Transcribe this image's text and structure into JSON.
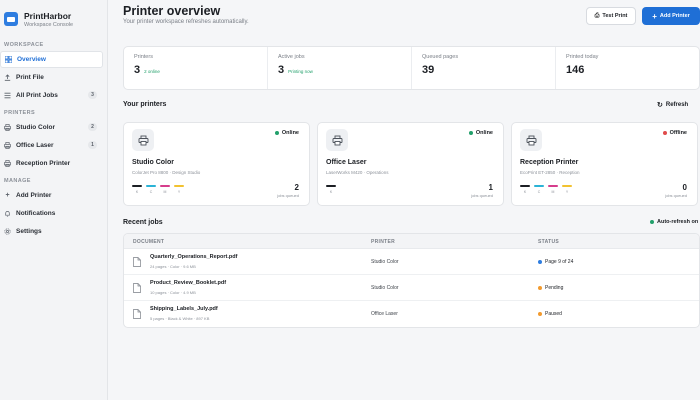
{
  "brand": {
    "name": "PrintHarbor",
    "subtitle": "Workspace Console"
  },
  "sidebar": {
    "workspace_label": "WORKSPACE",
    "workspace_items": [
      {
        "label": "Overview",
        "icon": "grid-icon"
      },
      {
        "label": "Print File",
        "icon": "upload-icon"
      },
      {
        "label": "All Print Jobs",
        "icon": "list-icon",
        "count": "3"
      }
    ],
    "printers_label": "PRINTERS",
    "printer_items": [
      {
        "label": "Studio Color",
        "icon": "printer-icon",
        "count": "2"
      },
      {
        "label": "Office Laser",
        "icon": "printer-icon",
        "count": "1"
      },
      {
        "label": "Reception Printer",
        "icon": "printer-icon"
      }
    ],
    "manage_label": "MANAGE",
    "manage_items": [
      {
        "label": "Add Printer",
        "icon": "plus-icon"
      },
      {
        "label": "Notifications",
        "icon": "bell-icon"
      },
      {
        "label": "Settings",
        "icon": "gear-icon"
      }
    ]
  },
  "header": {
    "title": "Printer overview",
    "subtitle": "Your printer workspace refreshes automatically.",
    "test_print_label": "Test Print",
    "add_printer_label": "Add Printer"
  },
  "stats": [
    {
      "label": "Printers",
      "value": "3",
      "note": "2 online"
    },
    {
      "label": "Active jobs",
      "value": "3",
      "note": "Printing now"
    },
    {
      "label": "Queued pages",
      "value": "39",
      "note": ""
    },
    {
      "label": "Printed today",
      "value": "146",
      "note": ""
    }
  ],
  "printers_section": {
    "title": "Your printers",
    "refresh_label": "Refresh"
  },
  "printers": [
    {
      "name": "Studio Color",
      "model": "ColorJet Pro 8800 · Design Studio",
      "status": "Online",
      "status_color": "#22a06b",
      "jobs": "2",
      "jobs_label": "jobs queued",
      "inks": [
        "K",
        "C",
        "M",
        "Y"
      ],
      "ink_colors": [
        "#1c1f24",
        "#2bb3d6",
        "#d63d8c",
        "#f2c230"
      ]
    },
    {
      "name": "Office Laser",
      "model": "LaserWorks M420 · Operations",
      "status": "Online",
      "status_color": "#22a06b",
      "jobs": "1",
      "jobs_label": "jobs queued",
      "inks": [
        "K"
      ],
      "ink_colors": [
        "#1c1f24"
      ]
    },
    {
      "name": "Reception Printer",
      "model": "EcoPrint ET-2850 · Reception",
      "status": "Offline",
      "status_color": "#e04b4b",
      "jobs": "0",
      "jobs_label": "jobs queued",
      "inks": [
        "K",
        "C",
        "M",
        "Y"
      ],
      "ink_colors": [
        "#1c1f24",
        "#2bb3d6",
        "#d63d8c",
        "#f2c230"
      ]
    }
  ],
  "jobs_section": {
    "title": "Recent jobs",
    "auto_refresh_label": "Auto-refresh on",
    "auto_refresh_color": "#22a06b"
  },
  "jobs_table": {
    "headers": [
      "DOCUMENT",
      "PRINTER",
      "STATUS"
    ],
    "rows": [
      {
        "name": "Quarterly_Operations_Report.pdf",
        "meta": "24 pages · Color · 9.6 MB",
        "printer": "Studio Color",
        "status": "Page 9 of 24",
        "status_color": "#2e7de0"
      },
      {
        "name": "Product_Review_Booklet.pdf",
        "meta": "10 pages · Color · 4.9 MB",
        "printer": "Studio Color",
        "status": "Pending",
        "status_color": "#f29a2e"
      },
      {
        "name": "Shipping_Labels_July.pdf",
        "meta": "5 pages · Black & White · 897 KB",
        "printer": "Office Laser",
        "status": "Paused",
        "status_color": "#f29a2e"
      }
    ]
  }
}
